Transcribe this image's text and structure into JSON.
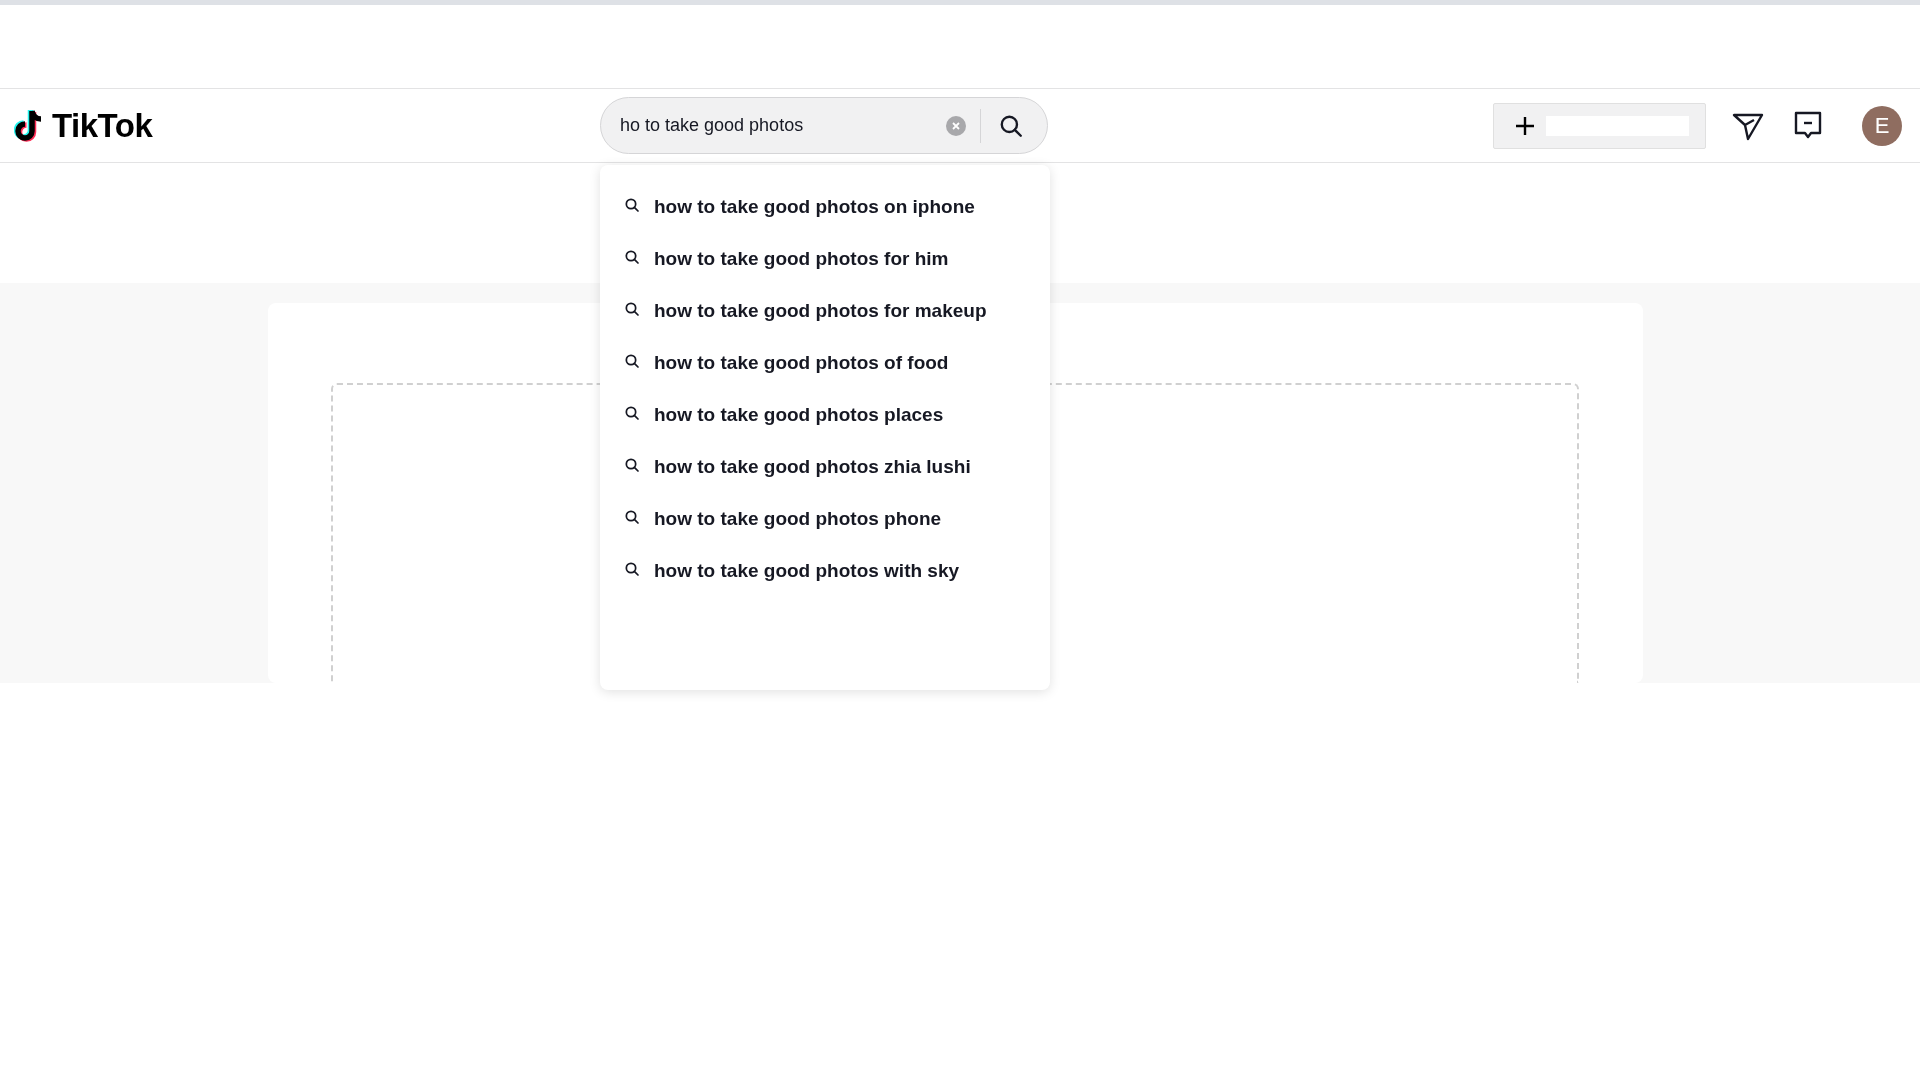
{
  "header": {
    "logo": "TikTok",
    "search": {
      "value": "ho to take good photos"
    },
    "avatar": "E"
  },
  "suggestions": [
    {
      "text": "how to take good photos on iphone"
    },
    {
      "text": "how to take good photos for him"
    },
    {
      "text": "how to take good photos for makeup"
    },
    {
      "text": "how to take good photos of food"
    },
    {
      "text": "how to take good photos places"
    },
    {
      "text": "how to take good photos zhia lushi"
    },
    {
      "text": "how to take good photos phone"
    },
    {
      "text": "how to take good photos with sky"
    }
  ]
}
